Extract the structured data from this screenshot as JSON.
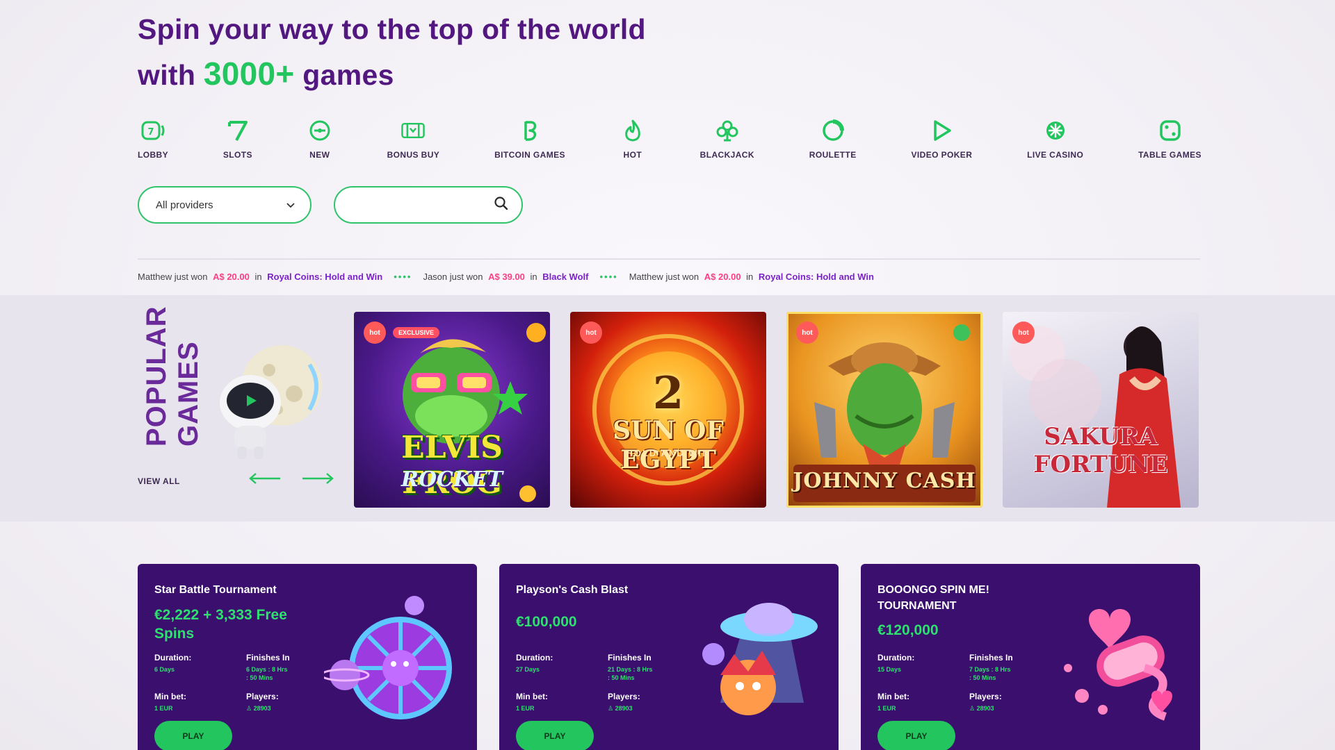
{
  "hero": {
    "line1": "Spin your way to the top of the world",
    "line2_prefix": "with",
    "line2_accent": "3000+",
    "line2_suffix": "games"
  },
  "categories": [
    {
      "label": "LOBBY",
      "icon": "lobby-icon"
    },
    {
      "label": "SLOTS",
      "icon": "seven-icon"
    },
    {
      "label": "NEW",
      "icon": "new-icon"
    },
    {
      "label": "BONUS BUY",
      "icon": "bonus-buy-icon"
    },
    {
      "label": "BITCOIN GAMES",
      "icon": "bitcoin-icon"
    },
    {
      "label": "HOT",
      "icon": "flame-icon"
    },
    {
      "label": "BLACKJACK",
      "icon": "club-icon"
    },
    {
      "label": "ROULETTE",
      "icon": "roulette-icon"
    },
    {
      "label": "VIDEO POKER",
      "icon": "play-icon"
    },
    {
      "label": "LIVE CASINO",
      "icon": "live-icon"
    },
    {
      "label": "TABLE GAMES",
      "icon": "dice-icon"
    }
  ],
  "filters": {
    "provider_selected": "All providers",
    "search_value": ""
  },
  "ticker": [
    {
      "user": "Matthew",
      "text": "just won",
      "amount": "A$ 20.00",
      "in": "in",
      "game": "Royal Coins: Hold and Win"
    },
    {
      "user": "Jason",
      "text": "just won",
      "amount": "A$ 39.00",
      "in": "in",
      "game": "Black Wolf"
    },
    {
      "user": "Matthew",
      "text": "just won",
      "amount": "A$ 20.00",
      "in": "in",
      "game": "Royal Coins: Hold and Win"
    }
  ],
  "ticker_separator": "••••",
  "popular": {
    "title_line1": "POPULAR",
    "title_line2": "GAMES",
    "view_all": "VIEW ALL",
    "games": [
      {
        "title": "ELVIS FROG",
        "subtitle": "ROCKET",
        "badge": "hot",
        "exclusive": "EXCLUSIVE"
      },
      {
        "title": "SUN OF EGYPT",
        "subtitle": "HOLD AND WIN",
        "number": "2",
        "badge": "hot"
      },
      {
        "title": "JOHNNY CASH",
        "badge": "hot"
      },
      {
        "title": "SAKURA FORTUNE",
        "badge": "hot"
      }
    ]
  },
  "promotions": [
    {
      "title": "Star Battle Tournament",
      "prize": "€2,222 + 3,333 Free Spins",
      "duration_label": "Duration:",
      "duration_value": "6 Days",
      "finishes_label": "Finishes In",
      "finishes_value": "6 Days : 8 Hrs\n: 50 Mins",
      "minbet_label": "Min bet:",
      "minbet_value": "1 EUR",
      "players_label": "Players:",
      "players_value": "28903",
      "play": "PLAY"
    },
    {
      "title": "Playson's Cash Blast",
      "prize": "€100,000",
      "duration_label": "Duration:",
      "duration_value": "27 Days",
      "finishes_label": "Finishes In",
      "finishes_value": "21 Days : 8 Hrs\n: 50 Mins",
      "minbet_label": "Min bet:",
      "minbet_value": "1 EUR",
      "players_label": "Players:",
      "players_value": "28903",
      "play": "PLAY"
    },
    {
      "title": "BOOONGO SPIN ME! TOURNAMENT",
      "prize": "€120,000",
      "duration_label": "Duration:",
      "duration_value": "15 Days",
      "finishes_label": "Finishes In",
      "finishes_value": "7 Days : 8 Hrs\n: 50 Mins",
      "minbet_label": "Min bet:",
      "minbet_value": "1 EUR",
      "players_label": "Players:",
      "players_value": "28903",
      "play": "PLAY"
    }
  ],
  "colors": {
    "accent_green": "#22c55e",
    "brand_purple": "#521880",
    "hot_red": "#ff5a5a",
    "promo_bg": "#3b0f6e"
  }
}
